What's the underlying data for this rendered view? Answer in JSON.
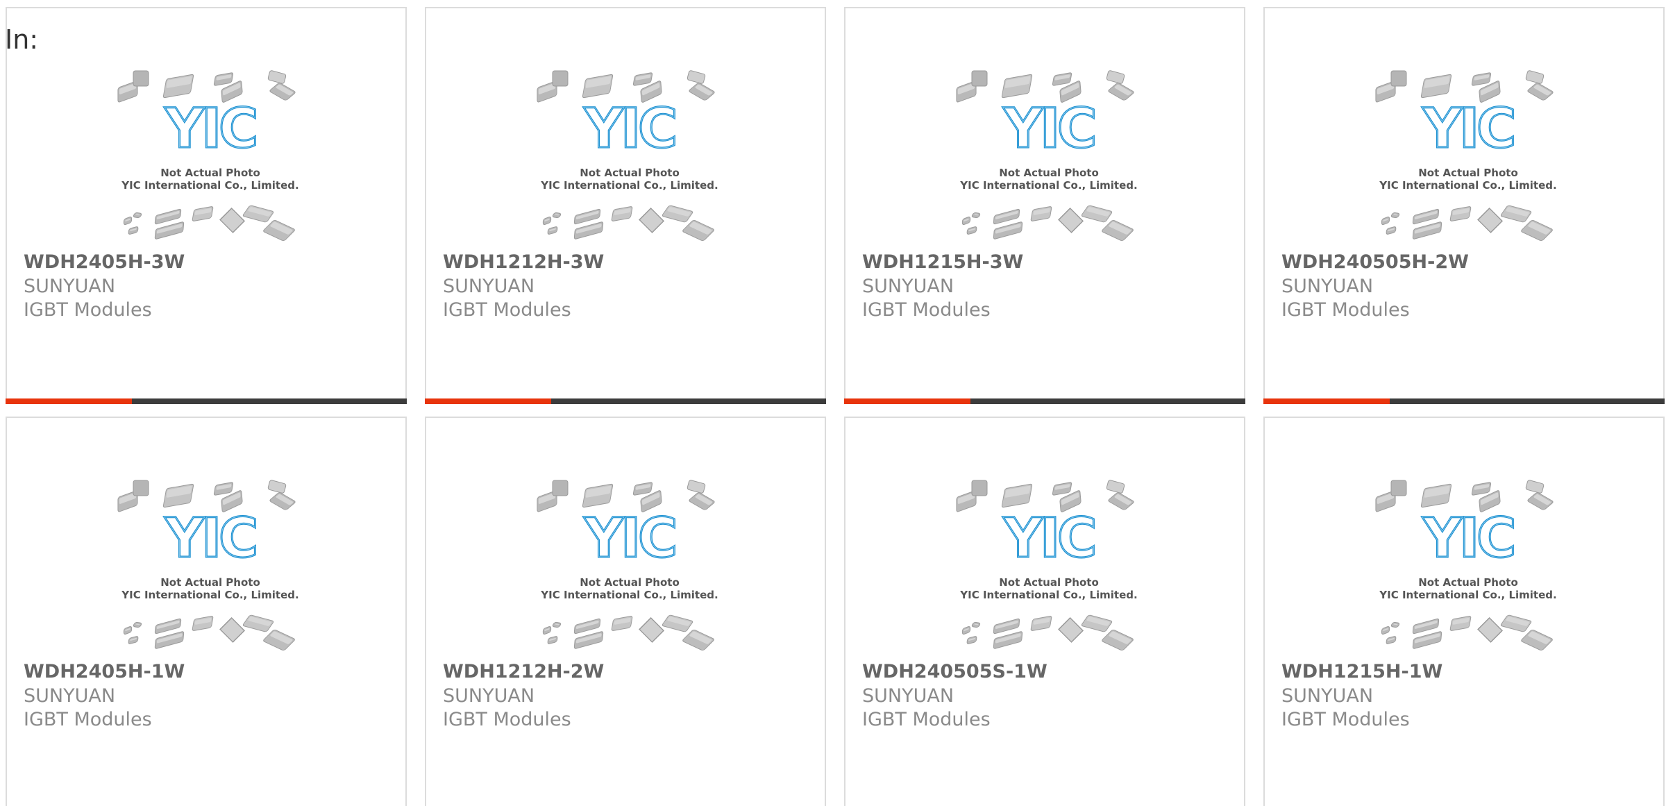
{
  "page": {
    "label": "In:"
  },
  "colors": {
    "accent": "#e8340c",
    "bar": "#3c3c3c",
    "logo_blue": "#1a8fd0"
  },
  "placeholder_image": {
    "logo_text": "YIC",
    "caption_line1": "Not Actual Photo",
    "caption_line2": "YIC International Co., Limited."
  },
  "products": [
    {
      "part_number": "WDH2405H-3W",
      "manufacturer": "SUNYUAN",
      "category": "IGBT Modules"
    },
    {
      "part_number": "WDH1212H-3W",
      "manufacturer": "SUNYUAN",
      "category": "IGBT Modules"
    },
    {
      "part_number": "WDH1215H-3W",
      "manufacturer": "SUNYUAN",
      "category": "IGBT Modules"
    },
    {
      "part_number": "WDH240505H-2W",
      "manufacturer": "SUNYUAN",
      "category": "IGBT Modules"
    },
    {
      "part_number": "WDH2405H-1W",
      "manufacturer": "SUNYUAN",
      "category": "IGBT Modules"
    },
    {
      "part_number": "WDH1212H-2W",
      "manufacturer": "SUNYUAN",
      "category": "IGBT Modules"
    },
    {
      "part_number": "WDH240505S-1W",
      "manufacturer": "SUNYUAN",
      "category": "IGBT Modules"
    },
    {
      "part_number": "WDH1215H-1W",
      "manufacturer": "SUNYUAN",
      "category": "IGBT Modules"
    }
  ]
}
